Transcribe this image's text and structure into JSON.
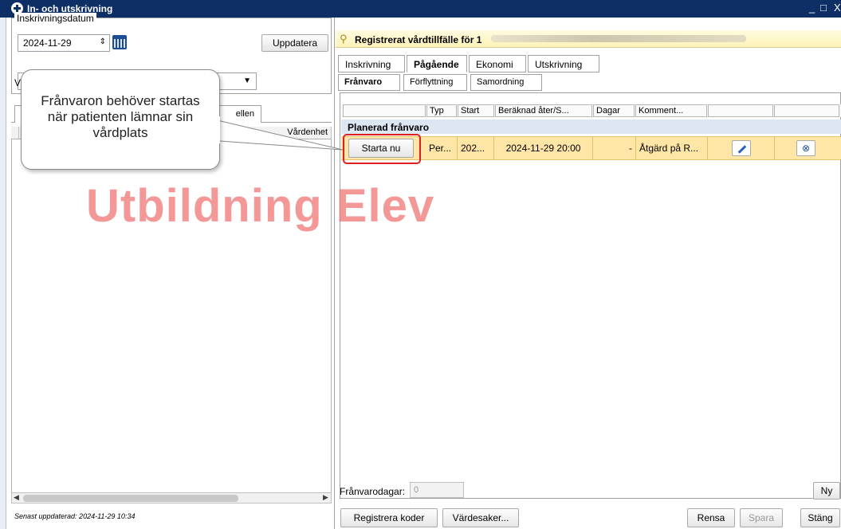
{
  "window": {
    "title": "In- och utskrivning",
    "controls": [
      "_",
      "□",
      "X"
    ]
  },
  "left": {
    "legend": "Inskrivningsdatum",
    "date_value": "2024-11-29",
    "update_button": "Uppdatera",
    "dropdown_prefix": "V",
    "tab_partial": "ellen",
    "grid_header_partial": "Vårdenhet",
    "status": "Senast uppdaterad: 2024-11-29 10:34"
  },
  "right": {
    "header_text": "Registrerat vårdtillfälle för 1",
    "main_tabs": [
      "Inskrivning",
      "Pågående",
      "Ekonomi",
      "Utskrivning"
    ],
    "sub_tabs": [
      "Frånvaro",
      "Förflyttning",
      "Samordning"
    ],
    "grid_headers": [
      "Typ",
      "Start",
      "Beräknad åter/S...",
      "Dagar",
      "Komment..."
    ],
    "group_label": "Planerad frånvaro",
    "row": {
      "start_button": "Starta nu",
      "typ": "Per...",
      "start": "202...",
      "beraknad": "2024-11-29 20:00",
      "dagar": "-",
      "kommentar": "Åtgärd på R..."
    },
    "franvarodagar_label": "Frånvarodagar:",
    "franvarodagar_value": "0",
    "ny_button": "Ny",
    "footer_buttons": {
      "registrera": "Registrera koder",
      "vardesaker": "Värdesaker...",
      "rensa": "Rensa",
      "spara": "Spara",
      "stang": "Stäng"
    }
  },
  "watermark": "Utbildning Elev",
  "callout": "Frånvaron behöver startas när patienten lämnar sin vårdplats"
}
